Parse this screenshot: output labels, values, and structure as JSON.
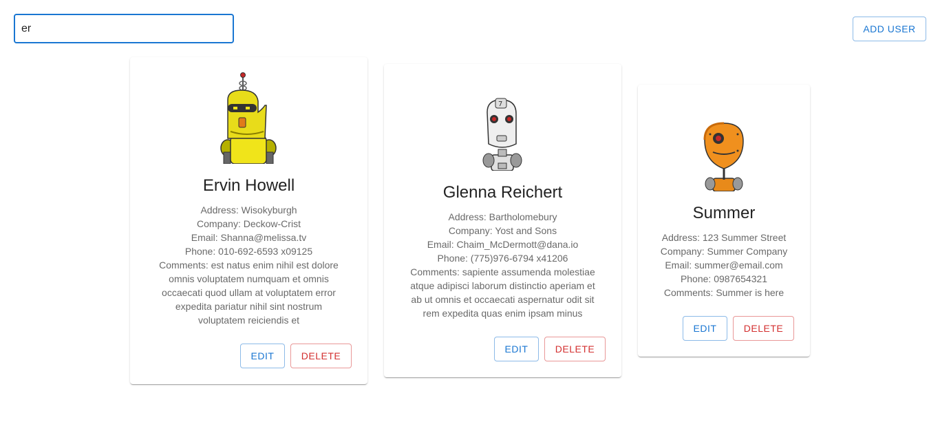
{
  "search": {
    "value": "er",
    "placeholder": ""
  },
  "toolbar": {
    "add_user_label": "ADD USER"
  },
  "colors": {
    "primary": "#1976d2",
    "error": "#d32f2f"
  },
  "users": [
    {
      "name": "Ervin Howell",
      "avatar_icon": "yellow-robot-avatar",
      "address": "Address: Wisokyburgh",
      "company": "Company: Deckow-Crist",
      "email": "Email: Shanna@melissa.tv",
      "phone": "Phone: 010-692-6593 x09125",
      "comments": "Comments: est natus enim nihil est dolore omnis voluptatem numquam et omnis occaecati quod ullam at voluptatem error expedita pariatur nihil sint nostrum voluptatem reiciendis et",
      "edit_label": "EDIT",
      "delete_label": "DELETE"
    },
    {
      "name": "Glenna Reichert",
      "avatar_icon": "white-robot-avatar",
      "address": "Address: Bartholomebury",
      "company": "Company: Yost and Sons",
      "email": "Email: Chaim_McDermott@dana.io",
      "phone": "Phone: (775)976-6794 x41206",
      "comments": "Comments: sapiente assumenda molestiae atque adipisci laborum distinctio aperiam et ab ut omnis et occaecati aspernatur odit sit rem expedita quas enim ipsam minus",
      "edit_label": "EDIT",
      "delete_label": "DELETE"
    },
    {
      "name": "Summer",
      "avatar_icon": "orange-robot-avatar",
      "address": "Address: 123 Summer Street",
      "company": "Company: Summer Company",
      "email": "Email: summer@email.com",
      "phone": "Phone: 0987654321",
      "comments": "Comments: Summer is here",
      "edit_label": "EDIT",
      "delete_label": "DELETE"
    }
  ]
}
